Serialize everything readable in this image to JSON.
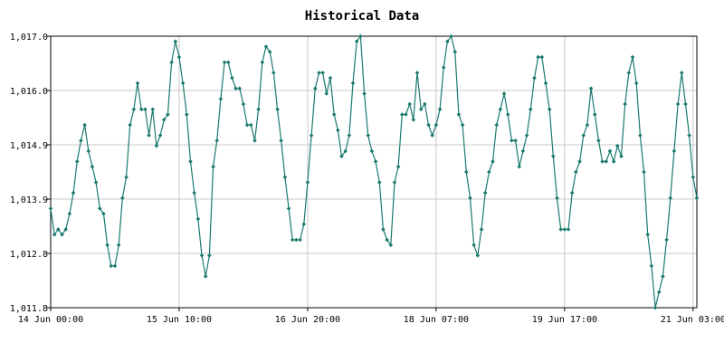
{
  "chart_data": {
    "type": "line",
    "title": "Historical Data",
    "xlabel": "",
    "ylabel": "",
    "x_tick_labels": [
      "14 Jun 00:00",
      "15 Jun 10:00",
      "16 Jun 20:00",
      "18 Jun 07:00",
      "19 Jun 17:00",
      "21 Jun 03:00"
    ],
    "y_tick_labels": [
      "1,011.8",
      "1,012.8",
      "1,013.9",
      "1,014.9",
      "1,016.0",
      "1,017.0"
    ],
    "y_tick_values": [
      1011.8,
      1012.84,
      1013.88,
      1014.92,
      1015.96,
      1017.0
    ],
    "ylim": [
      1011.8,
      1017.0
    ],
    "x_range_hours": [
      0,
      171
    ],
    "grid": true,
    "series": [
      {
        "color": "#1a7a6e",
        "marker": "diamond",
        "x_hours": [
          0,
          1,
          2,
          3,
          4,
          5,
          6,
          7,
          8,
          9,
          10,
          11,
          12,
          13,
          14,
          15,
          16,
          17,
          18,
          19,
          20,
          21,
          22,
          23,
          24,
          25,
          26,
          27,
          28,
          29,
          30,
          31,
          32,
          33,
          34,
          35,
          36,
          37,
          38,
          39,
          40,
          41,
          42,
          43,
          44,
          45,
          46,
          47,
          48,
          49,
          50,
          51,
          52,
          53,
          54,
          55,
          56,
          57,
          58,
          59,
          60,
          61,
          62,
          63,
          64,
          65,
          66,
          67,
          68,
          69,
          70,
          71,
          72,
          73,
          74,
          75,
          76,
          77,
          78,
          79,
          80,
          81,
          82,
          83,
          84,
          85,
          86,
          87,
          88,
          89,
          90,
          91,
          92,
          93,
          94,
          95,
          96,
          97,
          98,
          99,
          100,
          101,
          102,
          103,
          104,
          105,
          106,
          107,
          108,
          109,
          110,
          111,
          112,
          113,
          114,
          115,
          116,
          117,
          118,
          119,
          120,
          121,
          122,
          123,
          124,
          125,
          126,
          127,
          128,
          129,
          130,
          131,
          132,
          133,
          134,
          135,
          136,
          137,
          138,
          139,
          140,
          141,
          142,
          143,
          144,
          145,
          146,
          147,
          148,
          149,
          150,
          151,
          152,
          153,
          154,
          155,
          156,
          157,
          158,
          159,
          160,
          161,
          162,
          163,
          164,
          165,
          166,
          167,
          168,
          169,
          170,
          171
        ],
        "values": [
          1013.7,
          1013.2,
          1013.3,
          1013.2,
          1013.3,
          1013.6,
          1014.0,
          1014.6,
          1015.0,
          1015.3,
          1014.8,
          1014.5,
          1014.2,
          1013.7,
          1013.6,
          1013.0,
          1012.6,
          1012.6,
          1013.0,
          1013.9,
          1014.3,
          1015.3,
          1015.6,
          1016.1,
          1015.6,
          1015.6,
          1015.1,
          1015.6,
          1014.9,
          1015.1,
          1015.4,
          1015.5,
          1016.5,
          1016.9,
          1016.6,
          1016.1,
          1015.5,
          1014.6,
          1014.0,
          1013.5,
          1012.8,
          1012.4,
          1012.8,
          1014.5,
          1015.0,
          1015.8,
          1016.5,
          1016.5,
          1016.2,
          1016.0,
          1016.0,
          1015.7,
          1015.3,
          1015.3,
          1015.0,
          1015.6,
          1016.5,
          1016.8,
          1016.7,
          1016.3,
          1015.6,
          1015.0,
          1014.3,
          1013.7,
          1013.1,
          1013.1,
          1013.1,
          1013.4,
          1014.2,
          1015.1,
          1016.0,
          1016.3,
          1016.3,
          1015.9,
          1016.2,
          1015.5,
          1015.2,
          1014.7,
          1014.8,
          1015.1,
          1016.1,
          1016.9,
          1017.0,
          1015.9,
          1015.1,
          1014.8,
          1014.6,
          1014.2,
          1013.3,
          1013.1,
          1013.0,
          1014.2,
          1014.5,
          1015.5,
          1015.5,
          1015.7,
          1015.4,
          1016.3,
          1015.6,
          1015.7,
          1015.3,
          1015.1,
          1015.3,
          1015.6,
          1016.4,
          1016.9,
          1017.0,
          1016.7,
          1015.5,
          1015.3,
          1014.4,
          1013.9,
          1013.0,
          1012.8,
          1013.3,
          1014.0,
          1014.4,
          1014.6,
          1015.3,
          1015.6,
          1015.9,
          1015.5,
          1015.0,
          1015.0,
          1014.5,
          1014.8,
          1015.1,
          1015.6,
          1016.2,
          1016.6,
          1016.6,
          1016.1,
          1015.6,
          1014.7,
          1013.9,
          1013.3,
          1013.3,
          1013.3,
          1014.0,
          1014.4,
          1014.6,
          1015.1,
          1015.3,
          1016.0,
          1015.5,
          1015.0,
          1014.6,
          1014.6,
          1014.8,
          1014.6,
          1014.9,
          1014.7,
          1015.7,
          1016.3,
          1016.6,
          1016.1,
          1015.1,
          1014.4,
          1013.2,
          1012.6,
          1011.8,
          1012.1,
          1012.4,
          1013.1,
          1013.9,
          1014.8,
          1015.7,
          1016.3,
          1015.7,
          1015.1,
          1014.3,
          1013.9
        ]
      }
    ]
  }
}
